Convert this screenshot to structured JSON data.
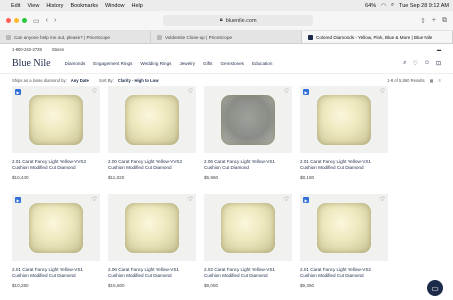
{
  "menubar": {
    "items": [
      "Edit",
      "View",
      "History",
      "Bookmarks",
      "Window",
      "Help"
    ],
    "battery": "64%",
    "datetime": "Tue Sep 28  9:12 AM"
  },
  "browser": {
    "url": "bluenile.com",
    "tabs": [
      "Can anyone help me out, please? | PriceScope",
      "Voldemite Close-up | PriceScope",
      "Colored Diamonds - Yellow, Pink, Blue & More | Blue Nile"
    ]
  },
  "site": {
    "phone": "1-800-242-2728",
    "location": "Stores",
    "logo": "Blue Nile",
    "nav": [
      "Diamonds",
      "Engagement Rings",
      "Wedding Rings",
      "Jewelry",
      "Gifts",
      "Gemstones",
      "Education"
    ],
    "filter": {
      "ships_label": "Ships as a loose diamond by:",
      "ships_value": "Any Date",
      "sort_label": "Sort By:",
      "sort_value": "Clarity - High to Low",
      "results": "1-8 of 5,860 Results"
    }
  },
  "products": [
    {
      "title": "2.01 Carat Fancy Light Yellow-VVS2 Cushion Modified Cut Diamond",
      "price": "$10,440"
    },
    {
      "title": "2.00 Carat Fancy Light Yellow-VVS2 Cushion Modified Cut Diamond",
      "price": "$11,020"
    },
    {
      "title": "2.06 Carat Fancy Light Yellow-VS1 Cushion Cut Diamond",
      "price": "$5,960"
    },
    {
      "title": "2.01 Carat Fancy Light Yellow-VS1 Cushion Modified Cut Diamond",
      "price": "$8,180"
    },
    {
      "title": "2.01 Carat Fancy Light Yellow-VS1 Cushion Modified Cut Diamond",
      "price": "$10,280"
    },
    {
      "title": "2.06 Carat Fancy Light Yellow-VS1 Cushion Modified Cut Diamond",
      "price": "$15,600"
    },
    {
      "title": "2.02 Carat Fancy Light Yellow-VS1 Cushion Modified Cut Diamond",
      "price": "$8,050"
    },
    {
      "title": "2.01 Carat Fancy Light Yellow-VS2 Cushion Modified Cut Diamond",
      "price": "$9,350"
    }
  ],
  "colors": {
    "brand": "#1c2b4a",
    "badge": "#2f6fd6"
  },
  "icons": [
    "apple-icon",
    "search-icon",
    "heart-icon",
    "chat-icon",
    "share-icon",
    "lock-icon"
  ]
}
